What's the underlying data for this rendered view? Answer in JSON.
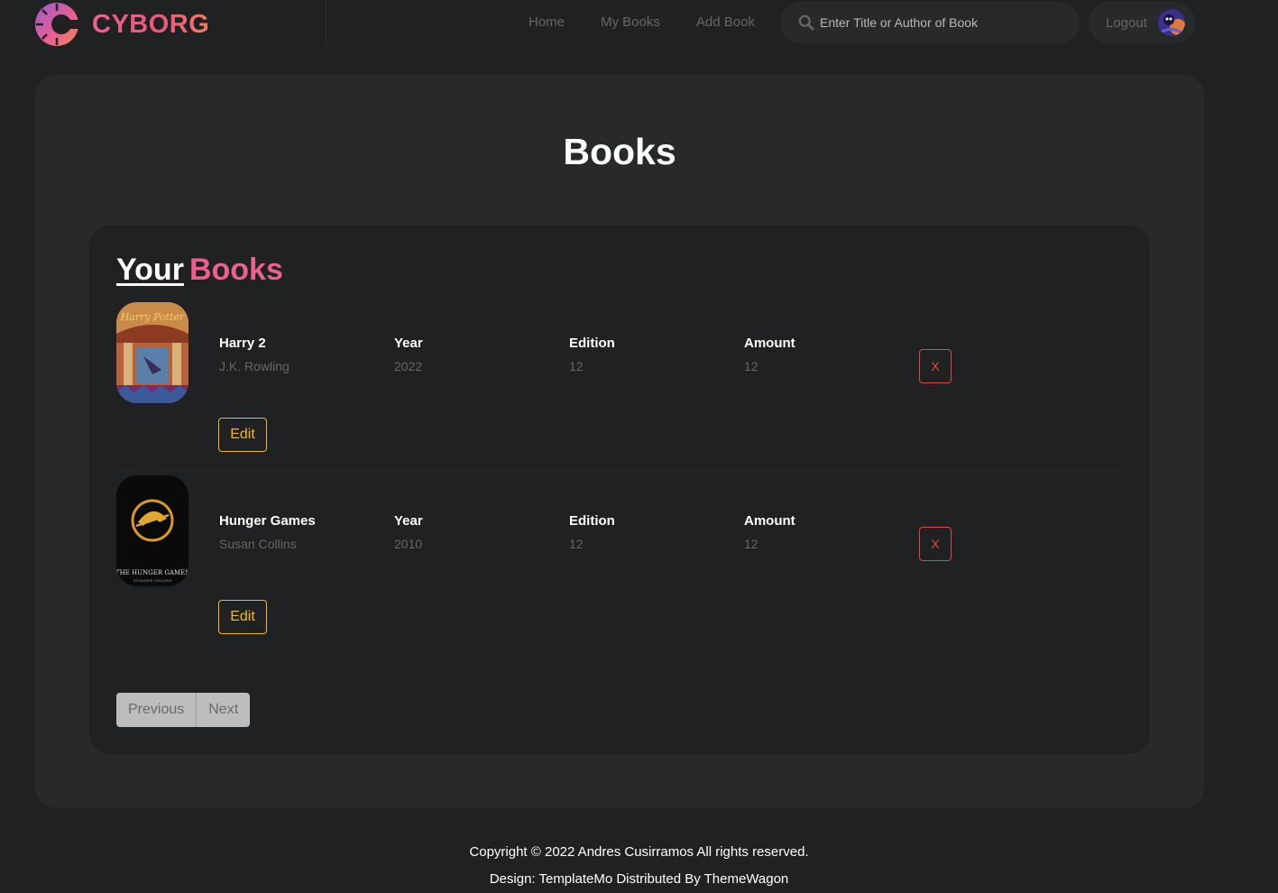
{
  "brand": {
    "name": "CYBORG"
  },
  "nav": {
    "home": "Home",
    "my_books": "My Books",
    "add_book": "Add Book"
  },
  "search": {
    "placeholder": "Enter Title or Author of Book"
  },
  "profile": {
    "logout_label": "Logout"
  },
  "page": {
    "title": "Books"
  },
  "section": {
    "title_part1": "Your",
    "title_part2": "Books"
  },
  "books": [
    {
      "title": "Harry 2",
      "author": "J.K. Rowling",
      "year_label": "Year",
      "year": "2022",
      "edition_label": "Edition",
      "edition": "12",
      "amount_label": "Amount",
      "amount": "12",
      "delete_label": "X",
      "edit_label": "Edit"
    },
    {
      "title": "Hunger Games",
      "author": "Susan Collins",
      "year_label": "Year",
      "year": "2010",
      "edition_label": "Edition",
      "edition": "12",
      "amount_label": "Amount",
      "amount": "12",
      "delete_label": "X",
      "edit_label": "Edit"
    }
  ],
  "pagination": {
    "previous": "Previous",
    "next": "Next"
  },
  "footer": {
    "copyright": "Copyright © 2022 Andres Cusirramos All rights reserved.",
    "design": "Design: TemplateMo Distributed By ThemeWagon"
  },
  "colors": {
    "accent": "#ec6090",
    "background": "#1f2122",
    "card": "#27292a",
    "edit": "#f5b81c",
    "delete": "#e5473b"
  }
}
